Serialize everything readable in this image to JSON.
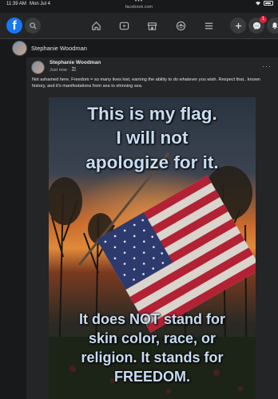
{
  "status_bar": {
    "time": "11:39 AM",
    "date": "Mon Jul 4",
    "url": "facebook.com",
    "dots": "•••"
  },
  "nav": {
    "logo": "f",
    "icons": [
      "search-icon",
      "home-icon",
      "watch-icon",
      "marketplace-icon",
      "groups-icon",
      "menu-icon",
      "plus-icon",
      "messenger-icon",
      "notifications-icon"
    ],
    "messenger_badge": "1"
  },
  "profile": {
    "name": "Stephanie Woodman"
  },
  "post": {
    "author": "Stephanie Woodman",
    "meta": "Just now ·",
    "more": "···",
    "text": "Not ashamed here. Freedom = so many lives lost, earning the ability to do whatever you wish. Respect that.. known history, and it's manifestations from sea to shinning sea.",
    "image": {
      "top_lines": [
        "This is my flag.",
        "I  will not",
        "apologize for it."
      ],
      "bottom_lines": [
        "It does NOT stand for",
        "skin color, race, or",
        "religion.  It stands for",
        "FREEDOM."
      ]
    }
  },
  "colors": {
    "background": "#18191a",
    "card": "#242526",
    "accent": "#1877f2",
    "badge": "#e41e3f",
    "meme_text": "#c8dcf2"
  }
}
